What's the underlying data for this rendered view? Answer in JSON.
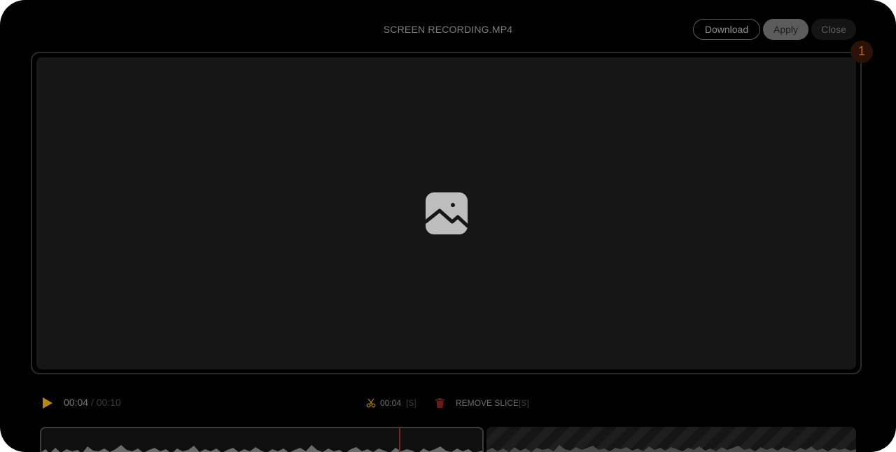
{
  "file": {
    "title": "SCREEN RECORDING.MP4"
  },
  "toolbar": {
    "download_label": "Download",
    "apply_label": "Apply",
    "close_label": "Close"
  },
  "preview": {
    "icon": "image-placeholder-icon",
    "badge": "1"
  },
  "player": {
    "play_icon": "play-icon",
    "current_time": "00:04",
    "separator": "/",
    "duration": "00:10",
    "cut_icon": "scissors-icon",
    "cut_time": "00:04",
    "cut_shortcut": "[S]",
    "remove_icon": "trash-icon",
    "remove_label": "REMOVE SLICE",
    "remove_shortcut": "[S]"
  },
  "timeline": {
    "slices": [
      {
        "state": "active"
      },
      {
        "state": "removed"
      }
    ],
    "playhead_fraction": 0.4
  },
  "colors": {
    "accent": "#b58b06",
    "badge_text": "#c6682b",
    "danger": "#6b1a1a",
    "background": "#000000"
  }
}
